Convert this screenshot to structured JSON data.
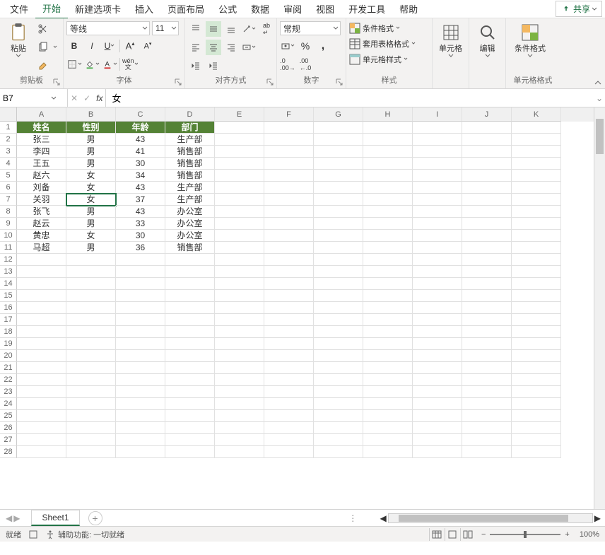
{
  "menu": {
    "file": "文件",
    "home": "开始",
    "newtab": "新建选项卡",
    "insert": "插入",
    "layout": "页面布局",
    "formula": "公式",
    "data": "数据",
    "review": "审阅",
    "view": "视图",
    "dev": "开发工具",
    "help": "帮助",
    "share": "共享"
  },
  "ribbon": {
    "clipboard": {
      "label": "剪贴板",
      "paste": "粘贴"
    },
    "font": {
      "label": "字体",
      "family": "等线",
      "size": "11"
    },
    "align": {
      "label": "对齐方式",
      "wrap": "ab"
    },
    "number": {
      "label": "数字",
      "format": "常规"
    },
    "styles": {
      "label": "样式",
      "cond": "条件格式",
      "table": "套用表格格式",
      "cell": "单元格样式"
    },
    "cells": {
      "label": "单元格"
    },
    "editing": {
      "label": "编辑"
    },
    "cellfmt": {
      "label": "单元格格式",
      "cond2": "条件格式"
    }
  },
  "namebox": "B7",
  "formula": "女",
  "headers": [
    "A",
    "B",
    "C",
    "D",
    "E",
    "F",
    "G",
    "H",
    "I",
    "J",
    "K"
  ],
  "colheaders": [
    "姓名",
    "性别",
    "年龄",
    "部门"
  ],
  "rows": [
    [
      "张三",
      "男",
      "43",
      "生产部"
    ],
    [
      "李四",
      "男",
      "41",
      "销售部"
    ],
    [
      "王五",
      "男",
      "30",
      "销售部"
    ],
    [
      "赵六",
      "女",
      "34",
      "销售部"
    ],
    [
      "刘备",
      "女",
      "43",
      "生产部"
    ],
    [
      "关羽",
      "女",
      "37",
      "生产部"
    ],
    [
      "张飞",
      "男",
      "43",
      "办公室"
    ],
    [
      "赵云",
      "男",
      "33",
      "办公室"
    ],
    [
      "黄忠",
      "女",
      "30",
      "办公室"
    ],
    [
      "马超",
      "男",
      "36",
      "销售部"
    ]
  ],
  "rowcount": 28,
  "sheet": "Sheet1",
  "status": {
    "ready": "就绪",
    "acc": "辅助功能: 一切就绪",
    "zoom": "100%"
  }
}
